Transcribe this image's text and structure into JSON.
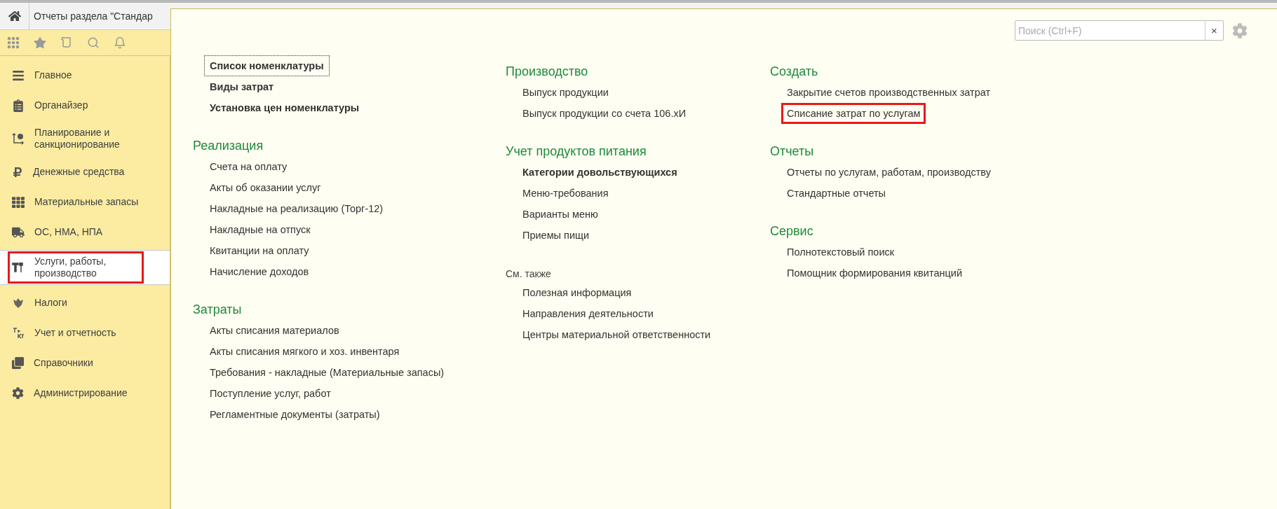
{
  "tab_bar": {
    "tab_title": "Отчеты раздела \"Стандар"
  },
  "sidebar": {
    "items": [
      {
        "label": "Главное",
        "selected": false,
        "marked": false
      },
      {
        "label": "Органайзер",
        "selected": false,
        "marked": false
      },
      {
        "label": "Планирование и санкционирование",
        "selected": false,
        "marked": false
      },
      {
        "label": "Денежные средства",
        "selected": false,
        "marked": false
      },
      {
        "label": "Материальные запасы",
        "selected": false,
        "marked": false
      },
      {
        "label": "ОС, НМА, НПА",
        "selected": false,
        "marked": false
      },
      {
        "label": "Услуги, работы, производство",
        "selected": true,
        "marked": true
      },
      {
        "label": "Налоги",
        "selected": false,
        "marked": false
      },
      {
        "label": "Учет и отчетность",
        "selected": false,
        "marked": false
      },
      {
        "label": "Справочники",
        "selected": false,
        "marked": false
      },
      {
        "label": "Администрирование",
        "selected": false,
        "marked": false
      }
    ]
  },
  "search": {
    "placeholder": "Поиск (Ctrl+F)",
    "clear": "×"
  },
  "columns": [
    {
      "groups": [
        {
          "items": [
            {
              "label": "Список номенклатуры",
              "bold": true,
              "focused": true,
              "marked": false
            },
            {
              "label": "Виды затрат",
              "bold": true,
              "focused": false,
              "marked": false
            },
            {
              "label": "Установка цен номенклатуры",
              "bold": true,
              "focused": false,
              "marked": false
            }
          ]
        },
        {
          "heading": "Реализация",
          "kind": "section",
          "items": [
            {
              "label": "Счета на оплату",
              "bold": false,
              "focused": false,
              "marked": false
            },
            {
              "label": "Акты об оказании услуг",
              "bold": false,
              "focused": false,
              "marked": false
            },
            {
              "label": "Накладные на реализацию (Торг-12)",
              "bold": false,
              "focused": false,
              "marked": false
            },
            {
              "label": "Накладные на отпуск",
              "bold": false,
              "focused": false,
              "marked": false
            },
            {
              "label": "Квитанции на оплату",
              "bold": false,
              "focused": false,
              "marked": false
            },
            {
              "label": "Начисление доходов",
              "bold": false,
              "focused": false,
              "marked": false
            }
          ]
        },
        {
          "heading": "Затраты",
          "kind": "section",
          "items": [
            {
              "label": "Акты списания материалов",
              "bold": false,
              "focused": false,
              "marked": false
            },
            {
              "label": "Акты списания мягкого и хоз. инвентаря",
              "bold": false,
              "focused": false,
              "marked": false
            },
            {
              "label": "Требования - накладные (Материальные запасы)",
              "bold": false,
              "focused": false,
              "marked": false
            },
            {
              "label": "Поступление услуг, работ",
              "bold": false,
              "focused": false,
              "marked": false
            },
            {
              "label": "Регламентные документы (затраты)",
              "bold": false,
              "focused": false,
              "marked": false
            }
          ]
        }
      ]
    },
    {
      "groups": [
        {
          "heading": "Производство",
          "kind": "section",
          "items": [
            {
              "label": "Выпуск продукции",
              "bold": false,
              "focused": false,
              "marked": false
            },
            {
              "label": "Выпуск продукции со счета 106.хИ",
              "bold": false,
              "focused": false,
              "marked": false
            }
          ]
        },
        {
          "heading": "Учет продуктов питания",
          "kind": "section",
          "items": [
            {
              "label": "Категории довольствующихся",
              "bold": true,
              "focused": false,
              "marked": false
            },
            {
              "label": "Меню-требования",
              "bold": false,
              "focused": false,
              "marked": false
            },
            {
              "label": "Варианты меню",
              "bold": false,
              "focused": false,
              "marked": false
            },
            {
              "label": "Приемы пищи",
              "bold": false,
              "focused": false,
              "marked": false
            }
          ]
        },
        {
          "heading": "См. также",
          "kind": "plain",
          "items": [
            {
              "label": "Полезная информация",
              "bold": false,
              "focused": false,
              "marked": false
            },
            {
              "label": "Направления деятельности",
              "bold": false,
              "focused": false,
              "marked": false
            },
            {
              "label": "Центры материальной ответственности",
              "bold": false,
              "focused": false,
              "marked": false
            }
          ]
        }
      ]
    },
    {
      "groups": [
        {
          "heading": "Создать",
          "kind": "section",
          "items": [
            {
              "label": "Закрытие счетов производственных затрат",
              "bold": false,
              "focused": false,
              "marked": false
            },
            {
              "label": "Списание затрат по услугам",
              "bold": false,
              "focused": false,
              "marked": true
            }
          ]
        },
        {
          "heading": "Отчеты",
          "kind": "section",
          "items": [
            {
              "label": "Отчеты по услугам, работам, производству",
              "bold": false,
              "focused": false,
              "marked": false
            },
            {
              "label": "Стандартные отчеты",
              "bold": false,
              "focused": false,
              "marked": false
            }
          ]
        },
        {
          "heading": "Сервис",
          "kind": "section",
          "items": [
            {
              "label": "Полнотекстовый поиск",
              "bold": false,
              "focused": false,
              "marked": false
            },
            {
              "label": "Помощник формирования квитанций",
              "bold": false,
              "focused": false,
              "marked": false
            }
          ]
        }
      ]
    }
  ]
}
